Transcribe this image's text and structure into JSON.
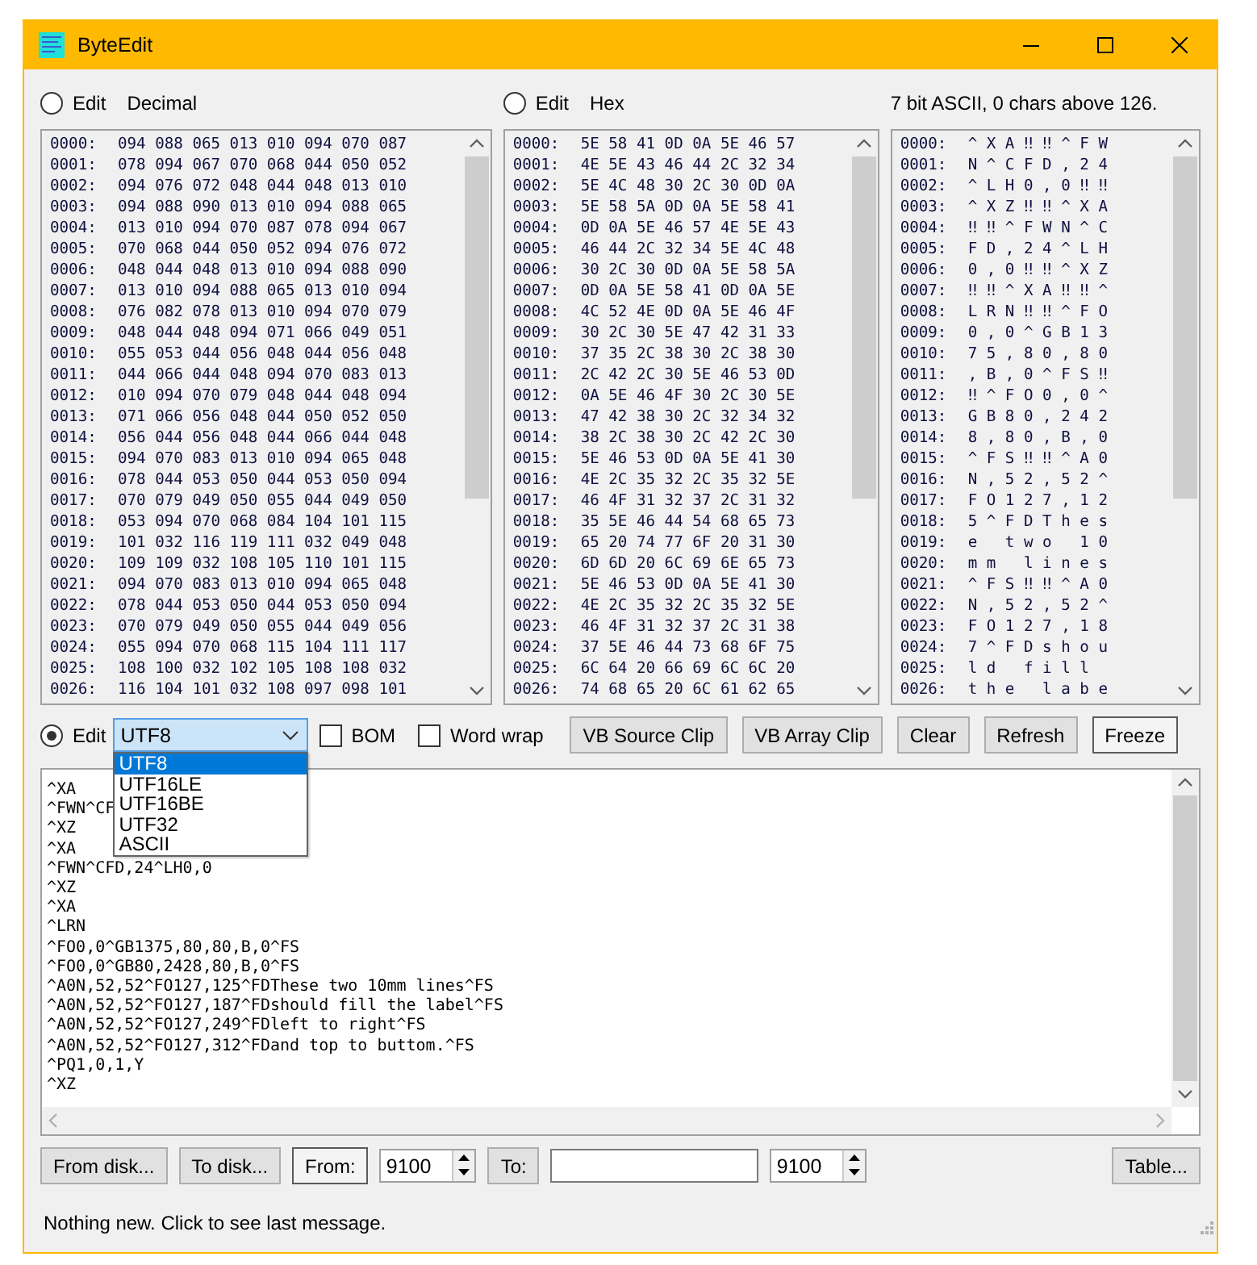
{
  "window": {
    "title": "ByteEdit"
  },
  "panels": [
    {
      "kind": "decimal",
      "edit": {
        "label": "Edit",
        "selected": false
      },
      "caption": "Decimal",
      "rows": [
        {
          "offset": "0000:",
          "values": "094 088 065 013 010 094 070 087"
        },
        {
          "offset": "0001:",
          "values": "078 094 067 070 068 044 050 052"
        },
        {
          "offset": "0002:",
          "values": "094 076 072 048 044 048 013 010"
        },
        {
          "offset": "0003:",
          "values": "094 088 090 013 010 094 088 065"
        },
        {
          "offset": "0004:",
          "values": "013 010 094 070 087 078 094 067"
        },
        {
          "offset": "0005:",
          "values": "070 068 044 050 052 094 076 072"
        },
        {
          "offset": "0006:",
          "values": "048 044 048 013 010 094 088 090"
        },
        {
          "offset": "0007:",
          "values": "013 010 094 088 065 013 010 094"
        },
        {
          "offset": "0008:",
          "values": "076 082 078 013 010 094 070 079"
        },
        {
          "offset": "0009:",
          "values": "048 044 048 094 071 066 049 051"
        },
        {
          "offset": "0010:",
          "values": "055 053 044 056 048 044 056 048"
        },
        {
          "offset": "0011:",
          "values": "044 066 044 048 094 070 083 013"
        },
        {
          "offset": "0012:",
          "values": "010 094 070 079 048 044 048 094"
        },
        {
          "offset": "0013:",
          "values": "071 066 056 048 044 050 052 050"
        },
        {
          "offset": "0014:",
          "values": "056 044 056 048 044 066 044 048"
        },
        {
          "offset": "0015:",
          "values": "094 070 083 013 010 094 065 048"
        },
        {
          "offset": "0016:",
          "values": "078 044 053 050 044 053 050 094"
        },
        {
          "offset": "0017:",
          "values": "070 079 049 050 055 044 049 050"
        },
        {
          "offset": "0018:",
          "values": "053 094 070 068 084 104 101 115"
        },
        {
          "offset": "0019:",
          "values": "101 032 116 119 111 032 049 048"
        },
        {
          "offset": "0020:",
          "values": "109 109 032 108 105 110 101 115"
        },
        {
          "offset": "0021:",
          "values": "094 070 083 013 010 094 065 048"
        },
        {
          "offset": "0022:",
          "values": "078 044 053 050 044 053 050 094"
        },
        {
          "offset": "0023:",
          "values": "070 079 049 050 055 044 049 056"
        },
        {
          "offset": "0024:",
          "values": "055 094 070 068 115 104 111 117"
        },
        {
          "offset": "0025:",
          "values": "108 100 032 102 105 108 108 032"
        },
        {
          "offset": "0026:",
          "values": "116 104 101 032 108 097 098 101"
        }
      ]
    },
    {
      "kind": "hex",
      "edit": {
        "label": "Edit",
        "selected": false
      },
      "caption": "Hex",
      "rows": [
        {
          "offset": "0000:",
          "values": "5E 58 41 0D 0A 5E 46 57"
        },
        {
          "offset": "0001:",
          "values": "4E 5E 43 46 44 2C 32 34"
        },
        {
          "offset": "0002:",
          "values": "5E 4C 48 30 2C 30 0D 0A"
        },
        {
          "offset": "0003:",
          "values": "5E 58 5A 0D 0A 5E 58 41"
        },
        {
          "offset": "0004:",
          "values": "0D 0A 5E 46 57 4E 5E 43"
        },
        {
          "offset": "0005:",
          "values": "46 44 2C 32 34 5E 4C 48"
        },
        {
          "offset": "0006:",
          "values": "30 2C 30 0D 0A 5E 58 5A"
        },
        {
          "offset": "0007:",
          "values": "0D 0A 5E 58 41 0D 0A 5E"
        },
        {
          "offset": "0008:",
          "values": "4C 52 4E 0D 0A 5E 46 4F"
        },
        {
          "offset": "0009:",
          "values": "30 2C 30 5E 47 42 31 33"
        },
        {
          "offset": "0010:",
          "values": "37 35 2C 38 30 2C 38 30"
        },
        {
          "offset": "0011:",
          "values": "2C 42 2C 30 5E 46 53 0D"
        },
        {
          "offset": "0012:",
          "values": "0A 5E 46 4F 30 2C 30 5E"
        },
        {
          "offset": "0013:",
          "values": "47 42 38 30 2C 32 34 32"
        },
        {
          "offset": "0014:",
          "values": "38 2C 38 30 2C 42 2C 30"
        },
        {
          "offset": "0015:",
          "values": "5E 46 53 0D 0A 5E 41 30"
        },
        {
          "offset": "0016:",
          "values": "4E 2C 35 32 2C 35 32 5E"
        },
        {
          "offset": "0017:",
          "values": "46 4F 31 32 37 2C 31 32"
        },
        {
          "offset": "0018:",
          "values": "35 5E 46 44 54 68 65 73"
        },
        {
          "offset": "0019:",
          "values": "65 20 74 77 6F 20 31 30"
        },
        {
          "offset": "0020:",
          "values": "6D 6D 20 6C 69 6E 65 73"
        },
        {
          "offset": "0021:",
          "values": "5E 46 53 0D 0A 5E 41 30"
        },
        {
          "offset": "0022:",
          "values": "4E 2C 35 32 2C 35 32 5E"
        },
        {
          "offset": "0023:",
          "values": "46 4F 31 32 37 2C 31 38"
        },
        {
          "offset": "0024:",
          "values": "37 5E 46 44 73 68 6F 75"
        },
        {
          "offset": "0025:",
          "values": "6C 64 20 66 69 6C 6C 20"
        },
        {
          "offset": "0026:",
          "values": "74 68 65 20 6C 61 62 65"
        }
      ]
    },
    {
      "kind": "ascii",
      "caption": "7 bit ASCII, 0 chars above 126.",
      "rows": [
        {
          "offset": "0000:",
          "values": "^ X A ‼ ‼ ^ F W"
        },
        {
          "offset": "0001:",
          "values": "N ^ C F D , 2 4"
        },
        {
          "offset": "0002:",
          "values": "^ L H 0 , 0 ‼ ‼"
        },
        {
          "offset": "0003:",
          "values": "^ X Z ‼ ‼ ^ X A"
        },
        {
          "offset": "0004:",
          "values": "‼ ‼ ^ F W N ^ C"
        },
        {
          "offset": "0005:",
          "values": "F D , 2 4 ^ L H"
        },
        {
          "offset": "0006:",
          "values": "0 , 0 ‼ ‼ ^ X Z"
        },
        {
          "offset": "0007:",
          "values": "‼ ‼ ^ X A ‼ ‼ ^"
        },
        {
          "offset": "0008:",
          "values": "L R N ‼ ‼ ^ F O"
        },
        {
          "offset": "0009:",
          "values": "0 , 0 ^ G B 1 3"
        },
        {
          "offset": "0010:",
          "values": "7 5 , 8 0 , 8 0"
        },
        {
          "offset": "0011:",
          "values": ", B , 0 ^ F S ‼"
        },
        {
          "offset": "0012:",
          "values": "‼ ^ F O 0 , 0 ^"
        },
        {
          "offset": "0013:",
          "values": "G B 8 0 , 2 4 2"
        },
        {
          "offset": "0014:",
          "values": "8 , 8 0 , B , 0"
        },
        {
          "offset": "0015:",
          "values": "^ F S ‼ ‼ ^ A 0"
        },
        {
          "offset": "0016:",
          "values": "N , 5 2 , 5 2 ^"
        },
        {
          "offset": "0017:",
          "values": "F O 1 2 7 , 1 2"
        },
        {
          "offset": "0018:",
          "values": "5 ^ F D T h e s"
        },
        {
          "offset": "0019:",
          "values": "e   t w o   1 0"
        },
        {
          "offset": "0020:",
          "values": "m m   l i n e s"
        },
        {
          "offset": "0021:",
          "values": "^ F S ‼ ‼ ^ A 0"
        },
        {
          "offset": "0022:",
          "values": "N , 5 2 , 5 2 ^"
        },
        {
          "offset": "0023:",
          "values": "F O 1 2 7 , 1 8"
        },
        {
          "offset": "0024:",
          "values": "7 ^ F D s h o u"
        },
        {
          "offset": "0025:",
          "values": "l d   f i l l"
        },
        {
          "offset": "0026:",
          "values": "t h e   l a b e"
        }
      ]
    }
  ],
  "editor": {
    "edit": {
      "label": "Edit",
      "selected": true
    },
    "encoding": {
      "value": "UTF8",
      "expanded": true,
      "options": [
        {
          "label": "UTF8",
          "selected": true
        },
        {
          "label": "UTF16LE",
          "selected": false
        },
        {
          "label": "UTF16BE",
          "selected": false
        },
        {
          "label": "UTF32",
          "selected": false
        },
        {
          "label": "ASCII",
          "selected": false
        }
      ]
    },
    "checkboxes": [
      {
        "label": "BOM",
        "checked": false
      },
      {
        "label": "Word wrap",
        "checked": false
      }
    ],
    "buttons": [
      {
        "kind": "button",
        "label": "VB Source Clip"
      },
      {
        "kind": "button",
        "label": "VB Array Clip"
      },
      {
        "kind": "button",
        "label": "Clear"
      },
      {
        "kind": "button",
        "label": "Refresh"
      },
      {
        "kind": "toggle",
        "label": "Freeze"
      }
    ],
    "lines": [
      "^XA",
      "^FWN^CF",
      "^XZ",
      "^XA",
      "^FWN^CFD,24^LH0,0",
      "^XZ",
      "^XA",
      "^LRN",
      "^FO0,0^GB1375,80,80,B,0^FS",
      "^FO0,0^GB80,2428,80,B,0^FS",
      "^A0N,52,52^FO127,125^FDThese two 10mm lines^FS",
      "^A0N,52,52^FO127,187^FDshould fill the label^FS",
      "^A0N,52,52^FO127,249^FDleft to right^FS",
      "^A0N,52,52^FO127,312^FDand top to buttom.^FS",
      "^PQ1,0,1,Y",
      "^XZ"
    ]
  },
  "bottom_bar": {
    "left": [
      {
        "kind": "button",
        "label": "From disk..."
      },
      {
        "kind": "button",
        "label": "To disk..."
      },
      {
        "kind": "toggle",
        "label": "From:"
      },
      {
        "kind": "spin",
        "value": "9100"
      },
      {
        "kind": "button",
        "label": "To:"
      },
      {
        "kind": "field"
      },
      {
        "kind": "spin",
        "value": "9100"
      }
    ],
    "right": [
      {
        "kind": "button",
        "label": "Table..."
      }
    ]
  },
  "status_bar": {
    "message": "Nothing new. Click to see last message."
  }
}
